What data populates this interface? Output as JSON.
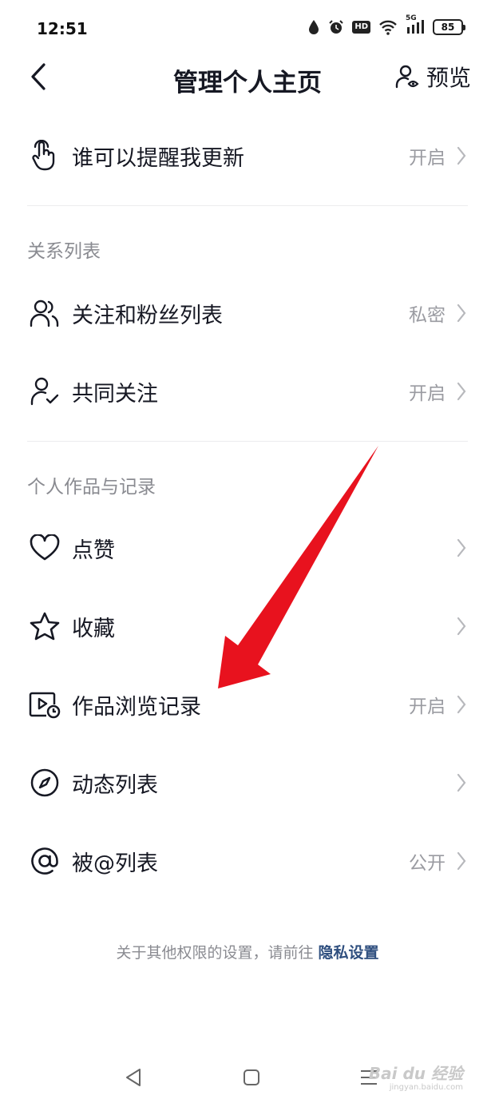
{
  "status_bar": {
    "time": "12:51",
    "hd": "HD",
    "network": "5G",
    "battery": "85"
  },
  "header": {
    "title": "管理个人主页",
    "preview_label": "预览"
  },
  "top_item": {
    "label": "谁可以提醒我更新",
    "value": "开启",
    "icon": "tap-finger-icon"
  },
  "sections": [
    {
      "title": "关系列表",
      "items": [
        {
          "label": "关注和粉丝列表",
          "value": "私密",
          "icon": "users-icon"
        },
        {
          "label": "共同关注",
          "value": "开启",
          "icon": "user-check-icon"
        }
      ]
    },
    {
      "title": "个人作品与记录",
      "items": [
        {
          "label": "点赞",
          "value": "",
          "icon": "heart-icon"
        },
        {
          "label": "收藏",
          "value": "",
          "icon": "star-icon"
        },
        {
          "label": "作品浏览记录",
          "value": "开启",
          "icon": "video-history-icon"
        },
        {
          "label": "动态列表",
          "value": "",
          "icon": "compass-icon"
        },
        {
          "label": "被@列表",
          "value": "公开",
          "icon": "at-icon"
        }
      ]
    }
  ],
  "footer": {
    "text": "关于其他权限的设置，请前往",
    "link": "隐私设置"
  },
  "watermark": {
    "text": "Bai du 经验",
    "sub": "jingyan.baidu.com"
  },
  "colors": {
    "text": "#161823",
    "secondary": "#9a9ba1",
    "link": "#2f4f7f",
    "arrow": "#e8121e"
  }
}
